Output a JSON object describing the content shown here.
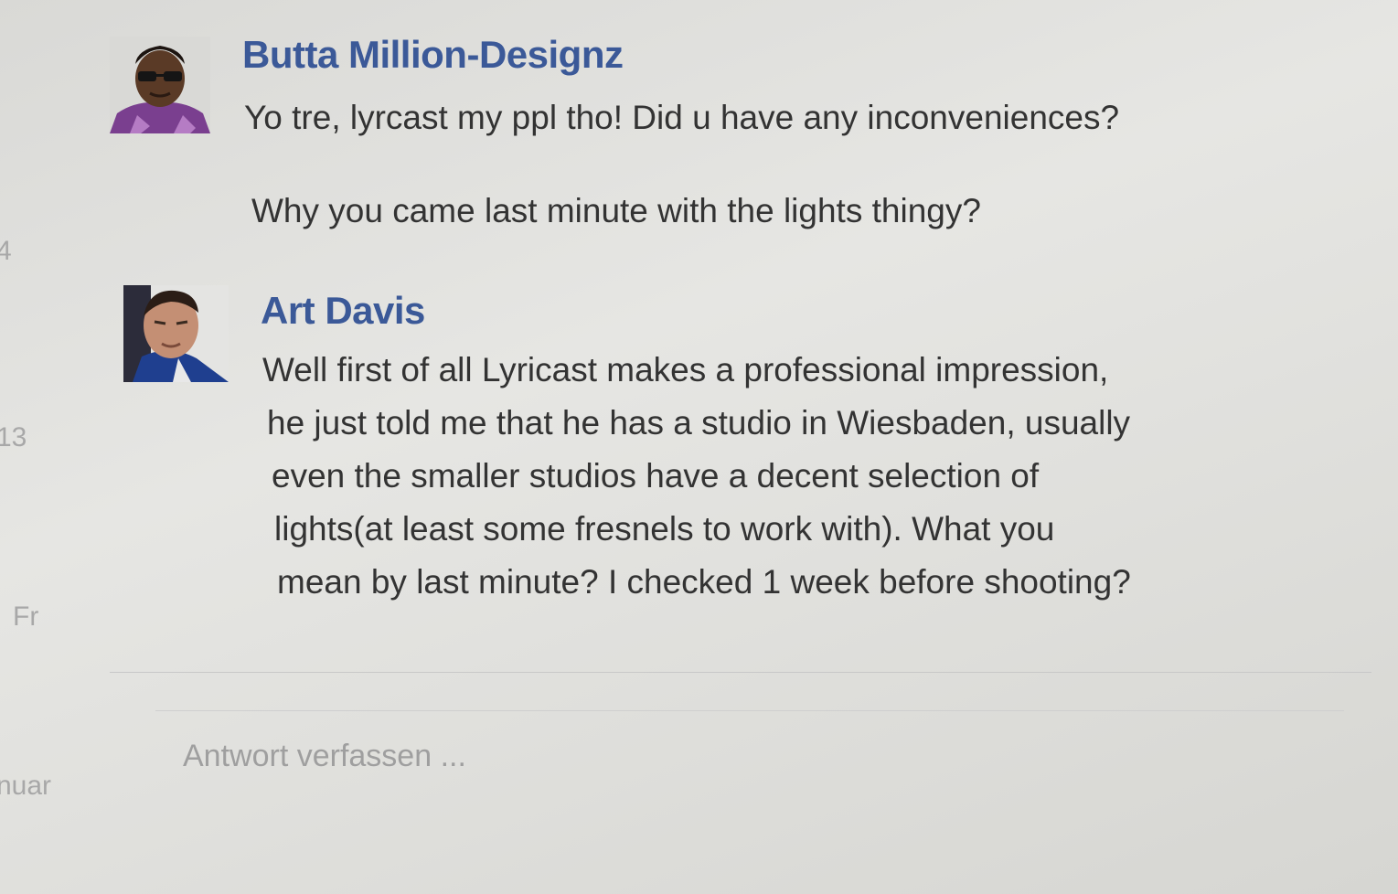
{
  "side_labels": [
    "4",
    "13",
    "Fr",
    "nuar"
  ],
  "messages": [
    {
      "author": "Butta Million-Designz",
      "lines": [
        "Yo tre, lyrcast my ppl tho! Did u have any inconveniences?",
        "",
        "Why you came last minute with the lights thingy?"
      ]
    },
    {
      "author": "Art Davis",
      "lines": [
        "Well first of all Lyricast makes a professional impression,",
        "he just told me that he has a studio in Wiesbaden, usually",
        "even the smaller studios have a decent selection of",
        "lights(at least some fresnels to work with). What you",
        "mean by last minute? I checked 1 week before shooting?"
      ]
    }
  ],
  "reply": {
    "placeholder": "Antwort verfassen ..."
  },
  "colors": {
    "author_name": "#3b5998",
    "message_text": "#333333",
    "muted": "#a8a8a8"
  }
}
